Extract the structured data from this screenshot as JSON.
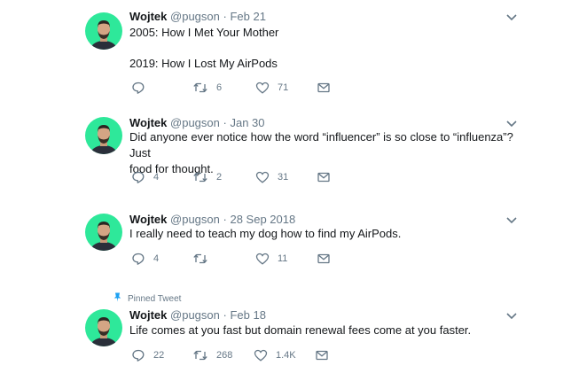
{
  "tweets": [
    {
      "author": {
        "name": "Wojtek",
        "handle": "@pugson"
      },
      "separator": "·",
      "date": "Feb 21",
      "pinned_label": "",
      "lines": [
        "2005: How I Met Your Mother",
        "2019: How I Lost My AirPods"
      ],
      "replies": "",
      "retweets": "6",
      "likes": "71"
    },
    {
      "author": {
        "name": "Wojtek",
        "handle": "@pugson"
      },
      "separator": "·",
      "date": "Jan 30",
      "pinned_label": "",
      "lines": [
        "Did anyone ever notice how the word “influencer” is so close to “influenza”? Just",
        "food for thought."
      ],
      "replies": "4",
      "retweets": "2",
      "likes": "31"
    },
    {
      "author": {
        "name": "Wojtek",
        "handle": "@pugson"
      },
      "separator": "·",
      "date": "28 Sep 2018",
      "pinned_label": "",
      "lines": [
        "I really need to teach my dog how to find my AirPods."
      ],
      "replies": "4",
      "retweets": "",
      "likes": "11"
    },
    {
      "author": {
        "name": "Wojtek",
        "handle": "@pugson"
      },
      "separator": "·",
      "date": "Feb 18",
      "pinned_label": "Pinned Tweet",
      "lines": [
        "Life comes at you fast but domain renewal fees come at you faster."
      ],
      "replies": "22",
      "retweets": "268",
      "likes": "1.4K"
    }
  ],
  "icons": {
    "reply": "reply-icon",
    "retweet": "retweet-icon",
    "like": "heart-icon",
    "dm": "envelope-icon",
    "caret": "chevron-down-icon",
    "pin": "pin-icon"
  },
  "colors": {
    "avatar_bg": "#2ee89a",
    "text": "#14171a",
    "secondary": "#657786",
    "pin": "#1da1f2"
  }
}
